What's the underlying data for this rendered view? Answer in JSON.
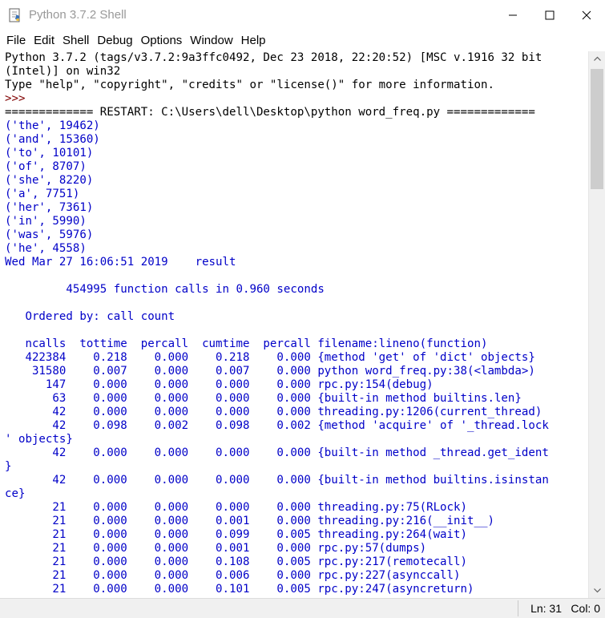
{
  "window": {
    "title": "Python 3.7.2 Shell"
  },
  "menu": [
    "File",
    "Edit",
    "Shell",
    "Debug",
    "Options",
    "Window",
    "Help"
  ],
  "colors": {
    "stdout_blue": "#0000c8",
    "text_black": "#000000",
    "prompt_maroon": "#800000"
  },
  "lines": [
    {
      "t": "Python 3.7.2 (tags/v3.7.2:9a3ffc0492, Dec 23 2018, 22:20:52) [MSC v.1916 32 bit",
      "c": "black"
    },
    {
      "t": "(Intel)] on win32",
      "c": "black"
    },
    {
      "t": "Type \"help\", \"copyright\", \"credits\" or \"license()\" for more information.",
      "c": "black"
    },
    {
      "t": ">>> ",
      "c": "maroon"
    },
    {
      "t": "============= RESTART: C:\\Users\\dell\\Desktop\\python word_freq.py =============",
      "c": "black"
    },
    {
      "t": "('the', 19462)",
      "c": "blue"
    },
    {
      "t": "('and', 15360)",
      "c": "blue"
    },
    {
      "t": "('to', 10101)",
      "c": "blue"
    },
    {
      "t": "('of', 8707)",
      "c": "blue"
    },
    {
      "t": "('she', 8220)",
      "c": "blue"
    },
    {
      "t": "('a', 7751)",
      "c": "blue"
    },
    {
      "t": "('her', 7361)",
      "c": "blue"
    },
    {
      "t": "('in', 5990)",
      "c": "blue"
    },
    {
      "t": "('was', 5976)",
      "c": "blue"
    },
    {
      "t": "('he', 4558)",
      "c": "blue"
    },
    {
      "t": "Wed Mar 27 16:06:51 2019    result",
      "c": "blue"
    },
    {
      "t": "",
      "c": "blue"
    },
    {
      "t": "         454995 function calls in 0.960 seconds",
      "c": "blue"
    },
    {
      "t": "",
      "c": "blue"
    },
    {
      "t": "   Ordered by: call count",
      "c": "blue"
    },
    {
      "t": "",
      "c": "blue"
    },
    {
      "t": "   ncalls  tottime  percall  cumtime  percall filename:lineno(function)",
      "c": "blue"
    },
    {
      "t": "   422384    0.218    0.000    0.218    0.000 {method 'get' of 'dict' objects}",
      "c": "blue"
    },
    {
      "t": "    31580    0.007    0.000    0.007    0.000 python word_freq.py:38(<lambda>)",
      "c": "blue"
    },
    {
      "t": "      147    0.000    0.000    0.000    0.000 rpc.py:154(debug)",
      "c": "blue"
    },
    {
      "t": "       63    0.000    0.000    0.000    0.000 {built-in method builtins.len}",
      "c": "blue"
    },
    {
      "t": "       42    0.000    0.000    0.000    0.000 threading.py:1206(current_thread)",
      "c": "blue"
    },
    {
      "t": "       42    0.098    0.002    0.098    0.002 {method 'acquire' of '_thread.lock",
      "c": "blue"
    },
    {
      "t": "' objects}",
      "c": "blue"
    },
    {
      "t": "       42    0.000    0.000    0.000    0.000 {built-in method _thread.get_ident",
      "c": "blue"
    },
    {
      "t": "}",
      "c": "blue"
    },
    {
      "t": "       42    0.000    0.000    0.000    0.000 {built-in method builtins.isinstan",
      "c": "blue"
    },
    {
      "t": "ce}",
      "c": "blue"
    },
    {
      "t": "       21    0.000    0.000    0.000    0.000 threading.py:75(RLock)",
      "c": "blue"
    },
    {
      "t": "       21    0.000    0.000    0.001    0.000 threading.py:216(__init__)",
      "c": "blue"
    },
    {
      "t": "       21    0.000    0.000    0.099    0.005 threading.py:264(wait)",
      "c": "blue"
    },
    {
      "t": "       21    0.000    0.000    0.001    0.000 rpc.py:57(dumps)",
      "c": "blue"
    },
    {
      "t": "       21    0.000    0.000    0.108    0.005 rpc.py:217(remotecall)",
      "c": "blue"
    },
    {
      "t": "       21    0.000    0.000    0.006    0.000 rpc.py:227(asynccall)",
      "c": "blue"
    },
    {
      "t": "       21    0.000    0.000    0.101    0.005 rpc.py:247(asyncreturn)",
      "c": "blue"
    }
  ],
  "status": {
    "ln": "Ln: 31",
    "col": "Col: 0"
  }
}
